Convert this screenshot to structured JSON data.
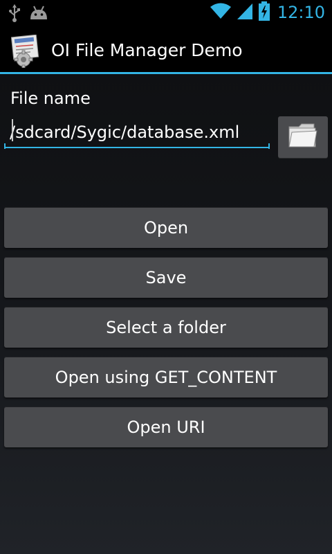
{
  "status_bar": {
    "time": "12:10",
    "icons": [
      "usb-icon",
      "android-icon",
      "wifi-icon",
      "signal-icon",
      "battery-charging-icon"
    ]
  },
  "action_bar": {
    "title": "OI File Manager Demo",
    "icon": "app-icon"
  },
  "form": {
    "file_label": "File name",
    "file_value": "/sdcard/Sygic/database.xml",
    "browse_icon": "folder-icon"
  },
  "buttons": {
    "open": "Open",
    "save": "Save",
    "select_folder": "Select a folder",
    "open_get_content": "Open using GET_CONTENT",
    "open_uri": "Open URI"
  },
  "colors": {
    "accent": "#33b5e5",
    "button_bg": "#4a4b4e",
    "background": "#0d0e10"
  }
}
